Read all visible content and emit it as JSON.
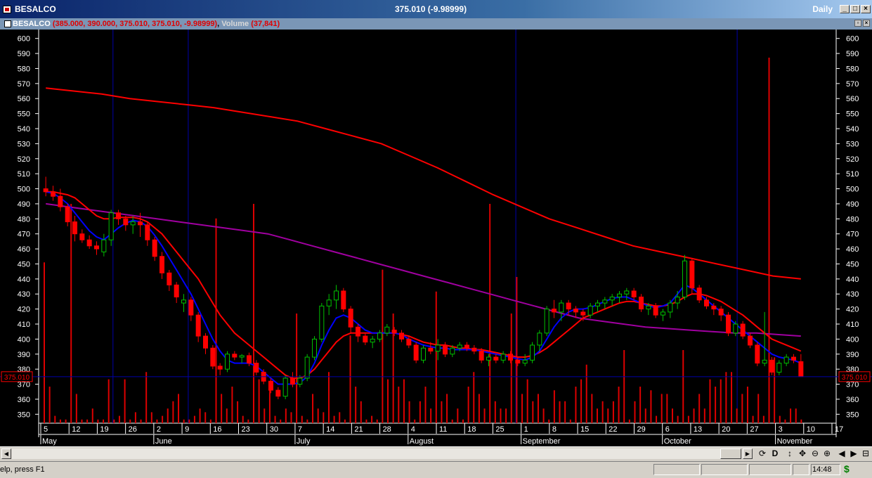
{
  "window": {
    "title": "BESALCO",
    "quote": "375.010 (-9.98999)",
    "period": "Daily",
    "minimize_glyph": "_",
    "restore_glyph": "□",
    "close_glyph": "×"
  },
  "subheader": {
    "symbol": "BESALCO",
    "ohlc": "(385.000, 390.000, 375.010, 375.010, -9.98999)",
    "volume_label": "Volume",
    "volume_value": "(37,841)"
  },
  "statusbar": {
    "help_text": "elp, press F1",
    "time": "14:48",
    "dollar_glyph": "$"
  },
  "toolbar": {
    "left_arrow": "◀",
    "right_arrow": "▶",
    "d_label": "D",
    "up_down": "↕",
    "move": "✥",
    "zoom_out": "⊖",
    "zoom_in": "⊕",
    "prev": "◀",
    "next": "▶",
    "grid": "⊟"
  },
  "colors": {
    "background": "#000000",
    "price_line": "#0000cc",
    "up_candle": "#00c000",
    "down_candle": "#ff0000",
    "volume_bar": "#dd0000",
    "ma_short": "#0000ff",
    "ma_medium": "#ff0000",
    "ma_long": "#a000a0",
    "ma_200": "#ff0000",
    "cursor_line": "#0000aa",
    "axis": "#ffffff"
  },
  "chart_data": {
    "type": "candlestick",
    "y_axis_ticks": [
      600,
      590,
      580,
      570,
      560,
      550,
      540,
      530,
      520,
      510,
      500,
      490,
      480,
      470,
      460,
      450,
      440,
      430,
      420,
      410,
      400,
      390,
      380,
      370,
      360,
      350
    ],
    "ylim": [
      345,
      605
    ],
    "price_tag": "375.010",
    "current_price": 375.01,
    "x_day_labels": [
      "5",
      "12",
      "19",
      "26",
      "2",
      "9",
      "16",
      "23",
      "30",
      "7",
      "14",
      "21",
      "28",
      "4",
      "11",
      "18",
      "25",
      "1",
      "8",
      "15",
      "22",
      "29",
      "6",
      "13",
      "20",
      "27",
      "3",
      "10",
      "17"
    ],
    "x_month_labels": [
      "May",
      "June",
      "July",
      "August",
      "September",
      "October",
      "November"
    ],
    "candles": [
      {
        "o": 500,
        "h": 508,
        "l": 495,
        "c": 498
      },
      {
        "o": 498,
        "h": 502,
        "l": 492,
        "c": 495
      },
      {
        "o": 495,
        "h": 500,
        "l": 485,
        "c": 488
      },
      {
        "o": 488,
        "h": 490,
        "l": 475,
        "c": 478
      },
      {
        "o": 478,
        "h": 482,
        "l": 465,
        "c": 470
      },
      {
        "o": 470,
        "h": 473,
        "l": 464,
        "c": 466
      },
      {
        "o": 466,
        "h": 469,
        "l": 460,
        "c": 462
      },
      {
        "o": 462,
        "h": 465,
        "l": 456,
        "c": 460
      },
      {
        "o": 458,
        "h": 470,
        "l": 455,
        "c": 466
      },
      {
        "o": 466,
        "h": 486,
        "l": 462,
        "c": 484
      },
      {
        "o": 484,
        "h": 486,
        "l": 476,
        "c": 480
      },
      {
        "o": 480,
        "h": 482,
        "l": 472,
        "c": 476
      },
      {
        "o": 476,
        "h": 482,
        "l": 470,
        "c": 478
      },
      {
        "o": 478,
        "h": 484,
        "l": 468,
        "c": 476
      },
      {
        "o": 476,
        "h": 478,
        "l": 462,
        "c": 466
      },
      {
        "o": 466,
        "h": 468,
        "l": 452,
        "c": 455
      },
      {
        "o": 455,
        "h": 458,
        "l": 440,
        "c": 444
      },
      {
        "o": 444,
        "h": 446,
        "l": 432,
        "c": 436
      },
      {
        "o": 436,
        "h": 438,
        "l": 424,
        "c": 428
      },
      {
        "o": 424,
        "h": 430,
        "l": 418,
        "c": 426
      },
      {
        "o": 426,
        "h": 428,
        "l": 412,
        "c": 416
      },
      {
        "o": 416,
        "h": 418,
        "l": 398,
        "c": 402
      },
      {
        "o": 402,
        "h": 404,
        "l": 390,
        "c": 394
      },
      {
        "o": 394,
        "h": 396,
        "l": 380,
        "c": 382
      },
      {
        "o": 382,
        "h": 384,
        "l": 376,
        "c": 380
      },
      {
        "o": 380,
        "h": 392,
        "l": 378,
        "c": 390
      },
      {
        "o": 390,
        "h": 392,
        "l": 386,
        "c": 388
      },
      {
        "o": 388,
        "h": 390,
        "l": 384,
        "c": 389
      },
      {
        "o": 389,
        "h": 391,
        "l": 382,
        "c": 384
      },
      {
        "o": 384,
        "h": 386,
        "l": 376,
        "c": 378
      },
      {
        "o": 378,
        "h": 380,
        "l": 370,
        "c": 372
      },
      {
        "o": 372,
        "h": 374,
        "l": 364,
        "c": 366
      },
      {
        "o": 366,
        "h": 368,
        "l": 360,
        "c": 362
      },
      {
        "o": 362,
        "h": 376,
        "l": 360,
        "c": 374
      },
      {
        "o": 374,
        "h": 378,
        "l": 368,
        "c": 370
      },
      {
        "o": 370,
        "h": 376,
        "l": 368,
        "c": 374
      },
      {
        "o": 374,
        "h": 390,
        "l": 372,
        "c": 388
      },
      {
        "o": 388,
        "h": 402,
        "l": 386,
        "c": 400
      },
      {
        "o": 400,
        "h": 424,
        "l": 398,
        "c": 422
      },
      {
        "o": 422,
        "h": 430,
        "l": 416,
        "c": 426
      },
      {
        "o": 426,
        "h": 436,
        "l": 420,
        "c": 432
      },
      {
        "o": 432,
        "h": 434,
        "l": 418,
        "c": 420
      },
      {
        "o": 420,
        "h": 422,
        "l": 404,
        "c": 408
      },
      {
        "o": 408,
        "h": 410,
        "l": 398,
        "c": 402
      },
      {
        "o": 402,
        "h": 404,
        "l": 396,
        "c": 398
      },
      {
        "o": 398,
        "h": 402,
        "l": 394,
        "c": 400
      },
      {
        "o": 400,
        "h": 406,
        "l": 398,
        "c": 404
      },
      {
        "o": 404,
        "h": 410,
        "l": 402,
        "c": 408
      },
      {
        "o": 406,
        "h": 408,
        "l": 402,
        "c": 404
      },
      {
        "o": 404,
        "h": 406,
        "l": 398,
        "c": 400
      },
      {
        "o": 400,
        "h": 402,
        "l": 394,
        "c": 396
      },
      {
        "o": 396,
        "h": 398,
        "l": 384,
        "c": 386
      },
      {
        "o": 386,
        "h": 396,
        "l": 384,
        "c": 394
      },
      {
        "o": 394,
        "h": 398,
        "l": 390,
        "c": 392
      },
      {
        "o": 392,
        "h": 400,
        "l": 386,
        "c": 396
      },
      {
        "o": 396,
        "h": 398,
        "l": 388,
        "c": 390
      },
      {
        "o": 390,
        "h": 396,
        "l": 388,
        "c": 394
      },
      {
        "o": 394,
        "h": 398,
        "l": 392,
        "c": 396
      },
      {
        "o": 396,
        "h": 398,
        "l": 392,
        "c": 394
      },
      {
        "o": 394,
        "h": 396,
        "l": 390,
        "c": 392
      },
      {
        "o": 392,
        "h": 394,
        "l": 384,
        "c": 386
      },
      {
        "o": 386,
        "h": 390,
        "l": 382,
        "c": 388
      },
      {
        "o": 388,
        "h": 390,
        "l": 384,
        "c": 386
      },
      {
        "o": 386,
        "h": 392,
        "l": 384,
        "c": 390
      },
      {
        "o": 390,
        "h": 392,
        "l": 384,
        "c": 386
      },
      {
        "o": 386,
        "h": 388,
        "l": 382,
        "c": 384
      },
      {
        "o": 384,
        "h": 390,
        "l": 382,
        "c": 386
      },
      {
        "o": 386,
        "h": 398,
        "l": 384,
        "c": 396
      },
      {
        "o": 396,
        "h": 406,
        "l": 392,
        "c": 404
      },
      {
        "o": 404,
        "h": 422,
        "l": 402,
        "c": 420
      },
      {
        "o": 420,
        "h": 426,
        "l": 414,
        "c": 418
      },
      {
        "o": 418,
        "h": 426,
        "l": 412,
        "c": 424
      },
      {
        "o": 424,
        "h": 426,
        "l": 416,
        "c": 420
      },
      {
        "o": 420,
        "h": 422,
        "l": 414,
        "c": 418
      },
      {
        "o": 418,
        "h": 420,
        "l": 412,
        "c": 416
      },
      {
        "o": 416,
        "h": 424,
        "l": 414,
        "c": 422
      },
      {
        "o": 422,
        "h": 426,
        "l": 418,
        "c": 424
      },
      {
        "o": 424,
        "h": 428,
        "l": 420,
        "c": 426
      },
      {
        "o": 426,
        "h": 430,
        "l": 422,
        "c": 428
      },
      {
        "o": 428,
        "h": 432,
        "l": 424,
        "c": 430
      },
      {
        "o": 430,
        "h": 434,
        "l": 426,
        "c": 432
      },
      {
        "o": 432,
        "h": 434,
        "l": 426,
        "c": 428
      },
      {
        "o": 428,
        "h": 430,
        "l": 418,
        "c": 420
      },
      {
        "o": 420,
        "h": 424,
        "l": 416,
        "c": 422
      },
      {
        "o": 422,
        "h": 424,
        "l": 414,
        "c": 416
      },
      {
        "o": 416,
        "h": 420,
        "l": 412,
        "c": 418
      },
      {
        "o": 418,
        "h": 426,
        "l": 414,
        "c": 424
      },
      {
        "o": 424,
        "h": 432,
        "l": 420,
        "c": 428
      },
      {
        "o": 428,
        "h": 456,
        "l": 426,
        "c": 452
      },
      {
        "o": 452,
        "h": 454,
        "l": 430,
        "c": 434
      },
      {
        "o": 434,
        "h": 436,
        "l": 424,
        "c": 426
      },
      {
        "o": 426,
        "h": 428,
        "l": 420,
        "c": 422
      },
      {
        "o": 422,
        "h": 424,
        "l": 416,
        "c": 420
      },
      {
        "o": 420,
        "h": 422,
        "l": 412,
        "c": 416
      },
      {
        "o": 416,
        "h": 418,
        "l": 402,
        "c": 404
      },
      {
        "o": 404,
        "h": 412,
        "l": 402,
        "c": 410
      },
      {
        "o": 410,
        "h": 412,
        "l": 400,
        "c": 402
      },
      {
        "o": 402,
        "h": 404,
        "l": 394,
        "c": 396
      },
      {
        "o": 396,
        "h": 398,
        "l": 382,
        "c": 384
      },
      {
        "o": 384,
        "h": 418,
        "l": 382,
        "c": 386
      },
      {
        "o": 386,
        "h": 388,
        "l": 376,
        "c": 378
      },
      {
        "o": 378,
        "h": 386,
        "l": 376,
        "c": 384
      },
      {
        "o": 384,
        "h": 390,
        "l": 382,
        "c": 388
      },
      {
        "o": 388,
        "h": 390,
        "l": 384,
        "c": 386
      },
      {
        "o": 385,
        "h": 390,
        "l": 375.01,
        "c": 375.01
      }
    ],
    "volumes": [
      44,
      10,
      2,
      1,
      1,
      60,
      8,
      1,
      1,
      4,
      1,
      1,
      12,
      1,
      2,
      12,
      1,
      3,
      1,
      14,
      3,
      1,
      2,
      4,
      6,
      8,
      1,
      1,
      2,
      4,
      3,
      1,
      56,
      8,
      4,
      10,
      6,
      2,
      1,
      60,
      12,
      4,
      10,
      2,
      1,
      4,
      3,
      30,
      2,
      1,
      8,
      4,
      3,
      14,
      2,
      3,
      1,
      24,
      10,
      6,
      1,
      2,
      1,
      42,
      12,
      30,
      10,
      12,
      6,
      1,
      6,
      10,
      4,
      36,
      6,
      8,
      1,
      4,
      1,
      10,
      14,
      8,
      4,
      60,
      6,
      4,
      4,
      30,
      40,
      8,
      12,
      6,
      8,
      4,
      1,
      9,
      6,
      6,
      1,
      10,
      12,
      16,
      8,
      4,
      6,
      4,
      6,
      10,
      20,
      1,
      6,
      10,
      4,
      9,
      2,
      8,
      8,
      4,
      2,
      20,
      2,
      4,
      8,
      4,
      12,
      10,
      12,
      14,
      14,
      4,
      8,
      10,
      2,
      8,
      2,
      100,
      18,
      2,
      1,
      4,
      4,
      1
    ],
    "vertical_markers_day_index": [
      16,
      33,
      107,
      157
    ],
    "ma_short": [
      498,
      497,
      494,
      490,
      484,
      478,
      472,
      468,
      466,
      470,
      474,
      477,
      479,
      478,
      475,
      469,
      462,
      454,
      446,
      438,
      430,
      420,
      410,
      400,
      392,
      386,
      384,
      384,
      384,
      382,
      378,
      374,
      370,
      370,
      370,
      371,
      375,
      384,
      396,
      406,
      414,
      416,
      414,
      410,
      406,
      404,
      404,
      404,
      404,
      403,
      400,
      398,
      396,
      395,
      394,
      394,
      393,
      393,
      393,
      393,
      392,
      391,
      390,
      389,
      388,
      387,
      386,
      388,
      392,
      400,
      408,
      414,
      418,
      420,
      420,
      421,
      423,
      425,
      427,
      428,
      428,
      426,
      424,
      422,
      421,
      422,
      424,
      430,
      436,
      434,
      430,
      426,
      422,
      418,
      414,
      410,
      406,
      402,
      398,
      394,
      390,
      388,
      387,
      386,
      384
    ],
    "ma_medium": [
      498,
      498,
      497,
      496,
      494,
      490,
      486,
      482,
      480,
      480,
      481,
      481,
      481,
      480,
      478,
      474,
      470,
      464,
      458,
      452,
      446,
      440,
      432,
      424,
      416,
      410,
      404,
      400,
      396,
      392,
      388,
      384,
      380,
      376,
      374,
      374,
      376,
      380,
      386,
      392,
      398,
      402,
      404,
      404,
      404,
      404,
      404,
      404,
      404,
      403,
      402,
      400,
      398,
      397,
      396,
      396,
      395,
      394,
      394,
      393,
      393,
      392,
      391,
      390,
      389,
      388,
      388,
      389,
      391,
      394,
      398,
      402,
      406,
      410,
      414,
      416,
      418,
      420,
      422,
      424,
      425,
      425,
      424,
      423,
      422,
      422,
      423,
      425,
      428,
      430,
      430,
      429,
      427,
      425,
      422,
      419,
      416,
      412,
      408,
      404,
      400,
      398,
      396,
      394,
      392
    ],
    "ma_long": [
      490,
      488,
      486,
      484,
      482,
      480,
      478,
      476,
      474,
      472,
      470,
      466,
      462,
      458,
      454,
      450,
      446,
      442,
      438,
      434,
      430,
      426,
      422,
      418,
      414,
      412,
      410,
      408,
      407,
      406,
      405,
      404,
      404,
      403,
      402
    ],
    "ma_200": [
      567,
      565,
      563,
      560,
      558,
      556,
      554,
      551,
      548,
      545,
      540,
      535,
      530,
      522,
      514,
      505,
      496,
      488,
      480,
      474,
      468,
      462,
      458,
      454,
      450,
      446,
      442,
      440
    ]
  }
}
